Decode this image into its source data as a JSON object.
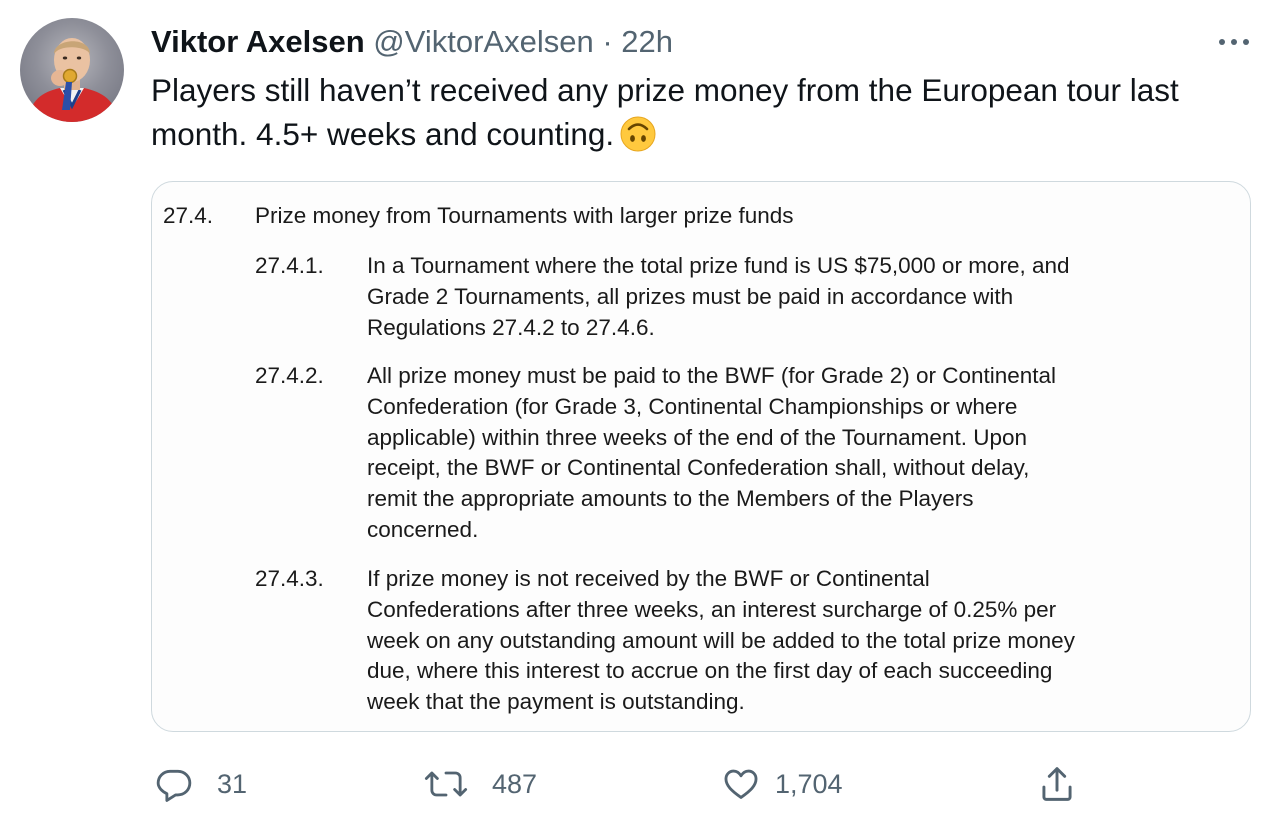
{
  "author": {
    "name": "Viktor Axelsen",
    "handle": "@ViktorAxelsen",
    "separator": "·",
    "time": "22h"
  },
  "tweet": {
    "text": "Players still haven’t received any prize money from the European tour last month. 4.5+ weeks and counting.",
    "emoji": "upside-down-face-emoji"
  },
  "document": {
    "section_number": "27.4.",
    "section_title": "Prize money from Tournaments with larger prize funds",
    "subsections": [
      {
        "number": "27.4.1.",
        "lines": [
          "In a Tournament where the total prize fund is US $75,000 or more, and",
          "Grade 2 Tournaments, all prizes must be paid in accordance with",
          "Regulations 27.4.2 to 27.4.6."
        ]
      },
      {
        "number": "27.4.2.",
        "lines": [
          "All prize money must be paid to the BWF (for Grade 2) or Continental",
          "Confederation (for Grade 3, Continental Championships or where",
          "applicable) within three weeks of the end of the Tournament.  Upon",
          "receipt, the BWF or Continental Confederation shall, without delay,",
          "remit the appropriate amounts to the Members of the Players",
          "concerned."
        ]
      },
      {
        "number": "27.4.3.",
        "lines": [
          "If prize money is not received by the BWF or Continental",
          "Confederations after three weeks, an interest surcharge of 0.25% per",
          "week on any outstanding amount will be added to the total prize money",
          "due, where this interest to accrue on the first day of each succeeding",
          "week that the payment is outstanding."
        ]
      }
    ]
  },
  "actions": {
    "reply_count": "31",
    "retweet_count": "487",
    "like_count": "1,704",
    "icons": [
      "reply-icon",
      "retweet-icon",
      "like-icon",
      "share-icon"
    ]
  },
  "colors": {
    "text": "#0f1419",
    "secondary": "#536471",
    "border": "#cfd9de"
  }
}
